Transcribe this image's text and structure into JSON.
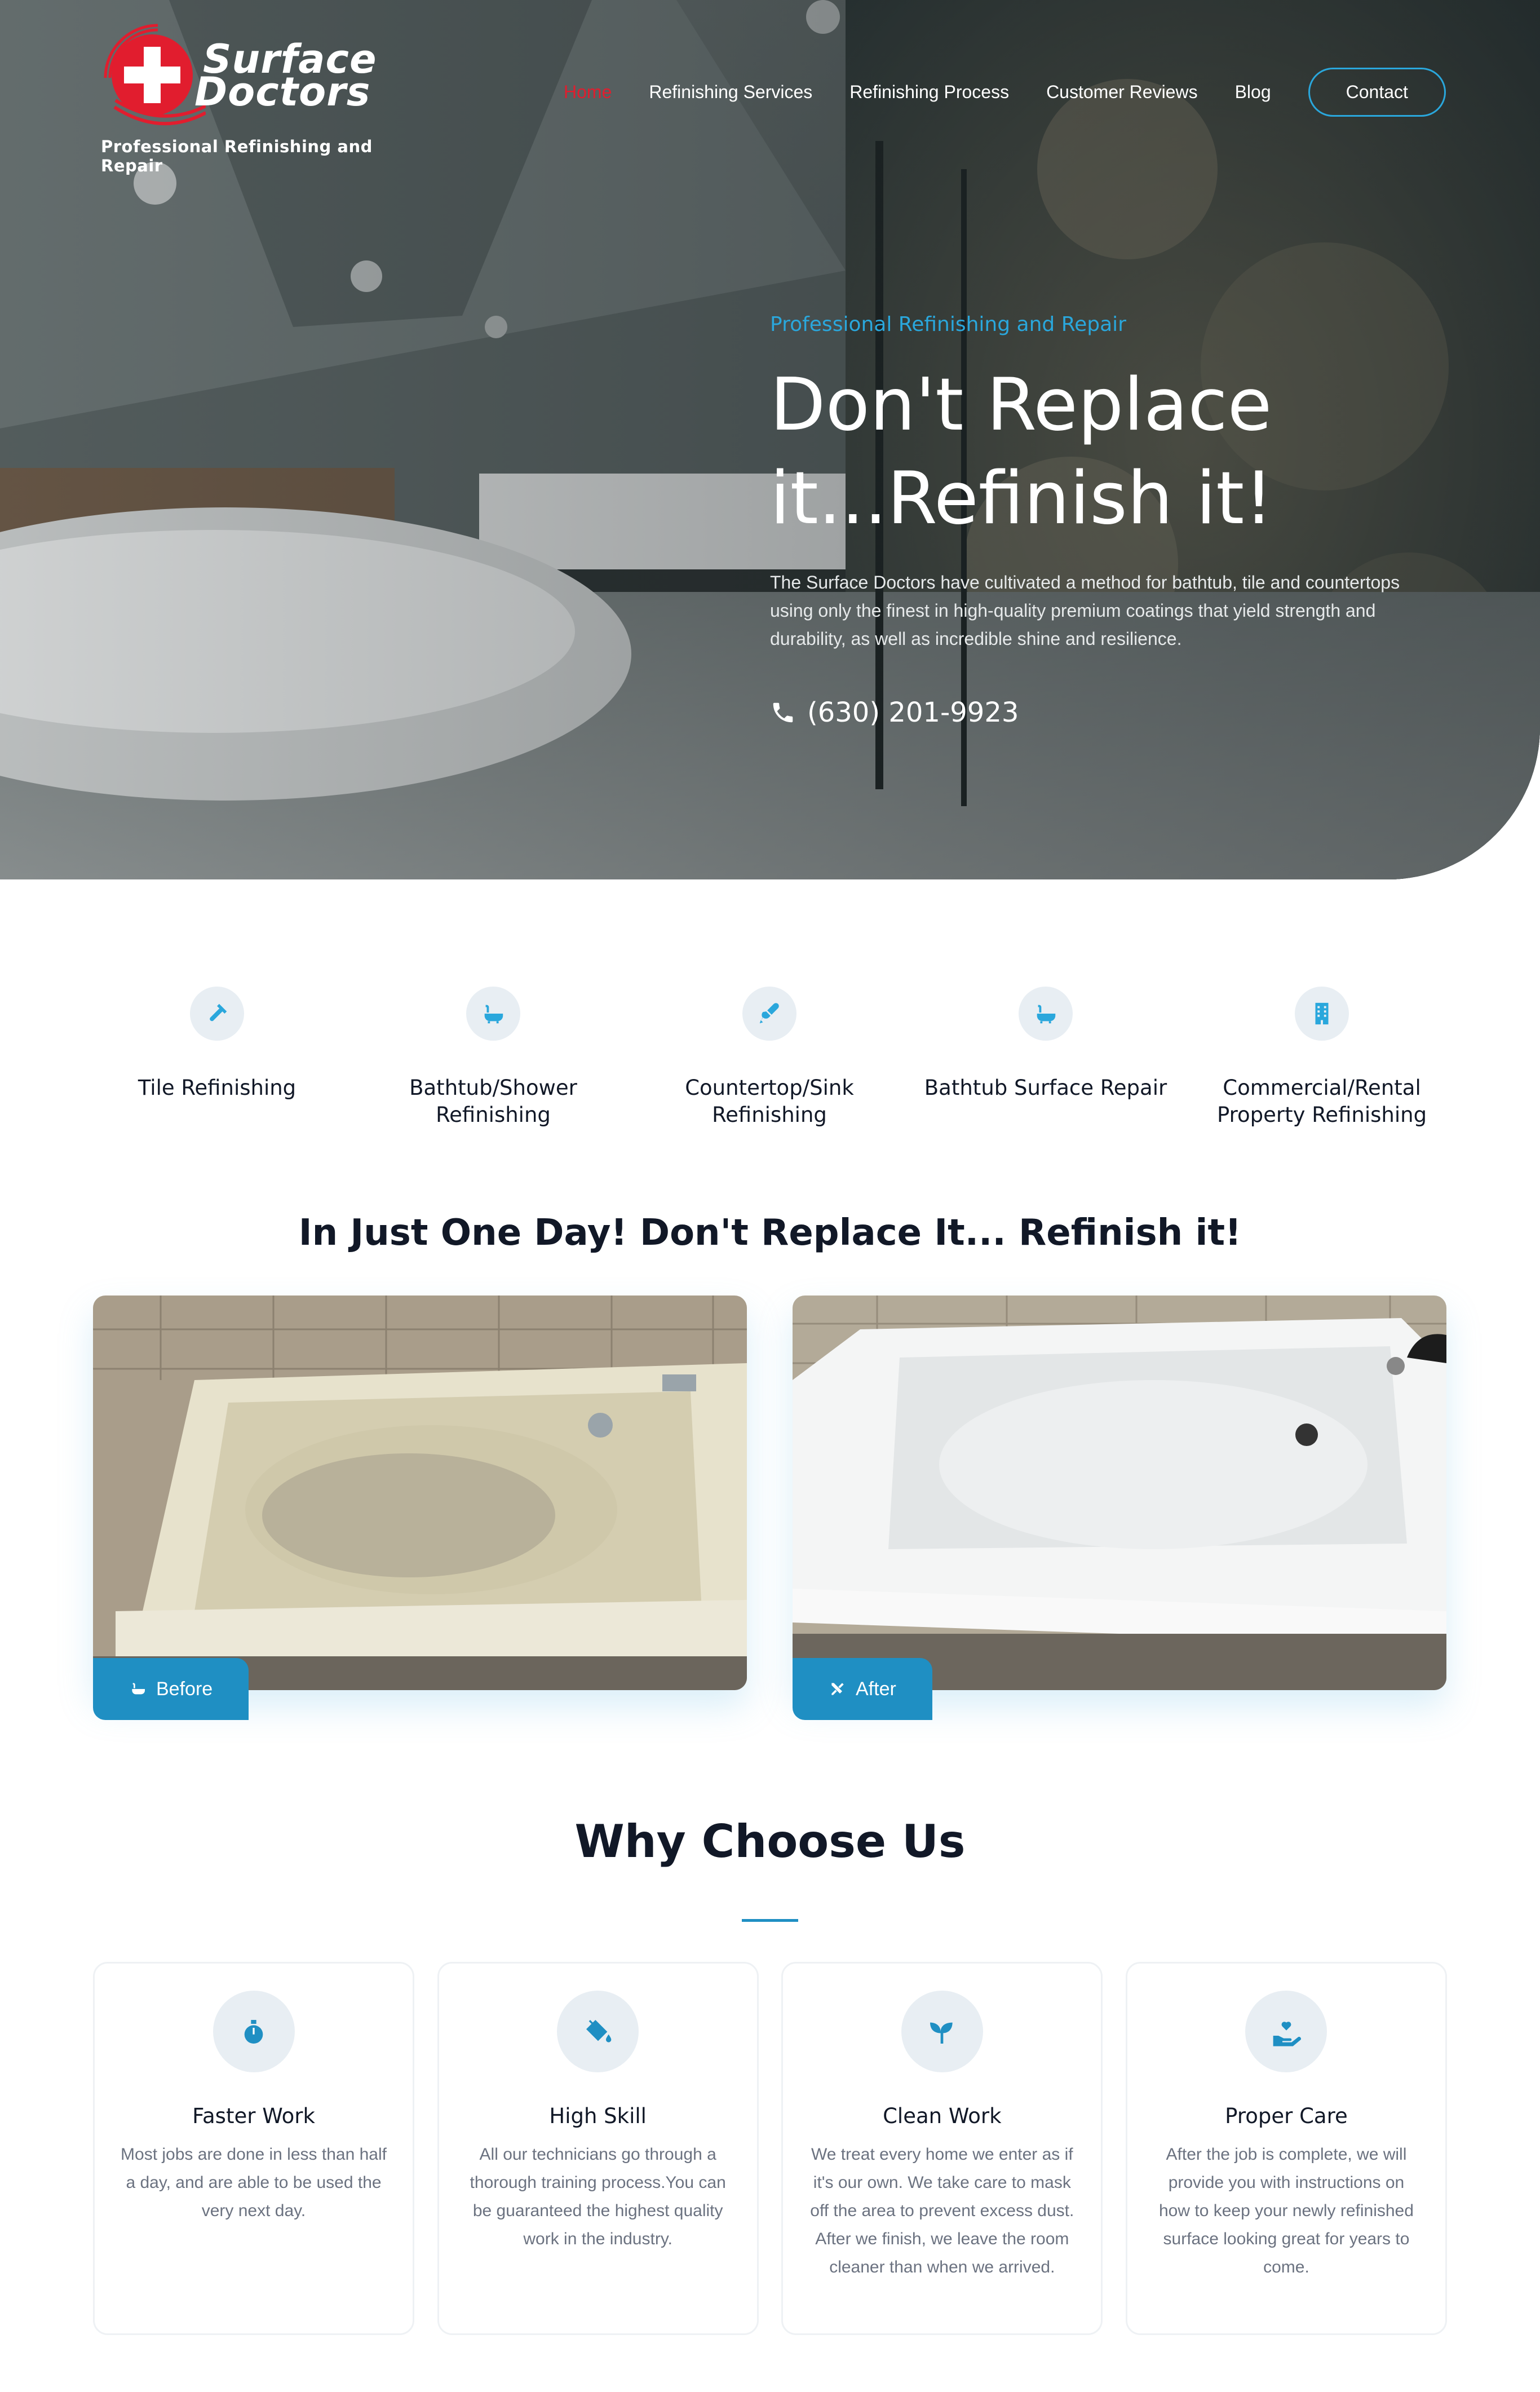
{
  "brand": {
    "name_line1": "Surface",
    "name_line2": "Doctors",
    "tagline": "Professional Refinishing and Repair",
    "colors": {
      "accent_red": "#e11d2e",
      "accent_blue": "#2aa7dc",
      "badge_blue": "#1f8fc3"
    }
  },
  "nav": {
    "items": [
      {
        "label": "Home",
        "active": true
      },
      {
        "label": "Refinishing Services"
      },
      {
        "label": "Refinishing Process"
      },
      {
        "label": "Customer Reviews"
      },
      {
        "label": "Blog"
      }
    ],
    "contact_label": "Contact"
  },
  "hero": {
    "eyebrow": "Professional Refinishing and Repair",
    "title_line1": "Don't Replace",
    "title_line2": "it...Refinish it!",
    "description": "The Surface Doctors have cultivated a method for bathtub, tile and countertops using only the finest in high-quality premium coatings that yield strength and durability, as well as incredible shine and resilience.",
    "phone": "(630) 201-9923",
    "phone_icon": "phone-icon"
  },
  "services": [
    {
      "label": "Tile Refinishing",
      "icon": "hammer-icon"
    },
    {
      "label": "Bathtub/Shower Refinishing",
      "icon": "bathtub-icon"
    },
    {
      "label": "Countertop/Sink Refinishing",
      "icon": "brush-icon"
    },
    {
      "label": "Bathtub Surface Repair",
      "icon": "bathtub-icon"
    },
    {
      "label": "Commercial/Rental Property Refinishing",
      "icon": "building-icon"
    }
  ],
  "before_after": {
    "headline": "In Just One Day! Don't Replace It... Refinish it!",
    "before_label": "Before",
    "after_label": "After"
  },
  "why": {
    "title": "Why Choose Us",
    "cards": [
      {
        "title": "Faster Work",
        "body": "Most jobs are done in less than half a day, and are able to be used the very next day.",
        "icon": "stopwatch-icon"
      },
      {
        "title": "High Skill",
        "body": "All our technicians go through a thorough training process.You can be guaranteed the highest quality work in the industry.",
        "icon": "paint-bucket-icon"
      },
      {
        "title": "Clean Work",
        "body": "We treat every home we enter as if it's our own. We take care to mask off the area to prevent excess dust. After we finish, we leave the room cleaner than when we arrived.",
        "icon": "seedling-icon"
      },
      {
        "title": "Proper Care",
        "body": "After the job is complete, we will provide you with instructions on how to keep your newly refinished surface looking great for years to come.",
        "icon": "hand-heart-icon"
      }
    ]
  }
}
